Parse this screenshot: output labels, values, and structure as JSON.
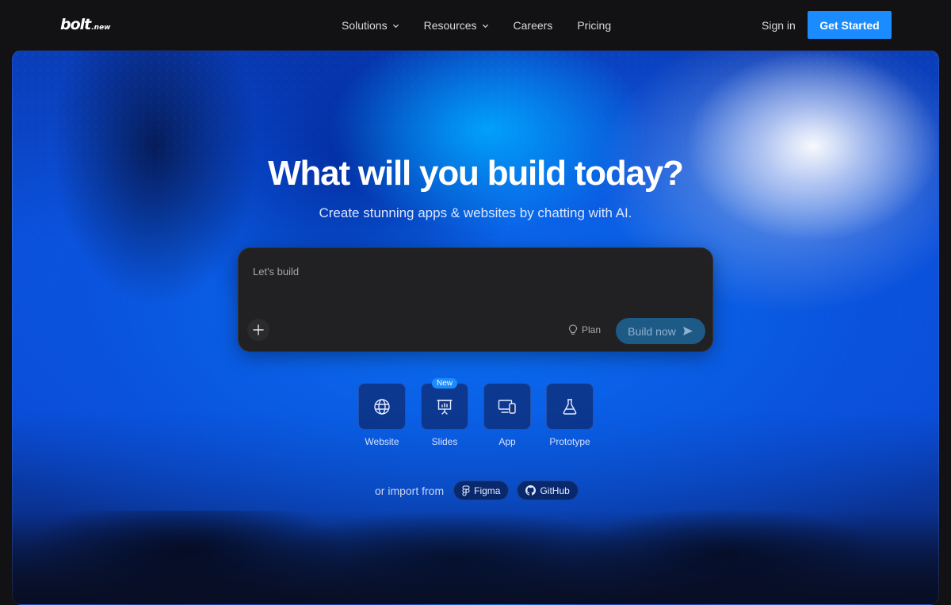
{
  "nav": {
    "logo_main": "bolt",
    "logo_sub": ".new",
    "links": [
      {
        "label": "Solutions",
        "dropdown": true
      },
      {
        "label": "Resources",
        "dropdown": true
      },
      {
        "label": "Careers",
        "dropdown": false
      },
      {
        "label": "Pricing",
        "dropdown": false
      }
    ],
    "signin": "Sign in",
    "cta": "Get Started"
  },
  "hero": {
    "title": "What will you build today?",
    "subtitle": "Create stunning apps & websites by chatting with AI."
  },
  "prompt": {
    "placeholder": "Let's build",
    "plan_label": "Plan",
    "build_label": "Build now"
  },
  "types": [
    {
      "label": "Website",
      "icon": "globe-icon",
      "badge": ""
    },
    {
      "label": "Slides",
      "icon": "presentation-icon",
      "badge": "New"
    },
    {
      "label": "App",
      "icon": "devices-icon",
      "badge": ""
    },
    {
      "label": "Prototype",
      "icon": "flask-icon",
      "badge": ""
    }
  ],
  "import": {
    "text": "or import from",
    "sources": [
      {
        "label": "Figma",
        "icon": "figma-icon"
      },
      {
        "label": "GitHub",
        "icon": "github-icon"
      }
    ]
  },
  "colors": {
    "accent": "#1a8cff",
    "background": "#121214",
    "prompt_bg": "#212123",
    "build_button": "#1e5a86"
  }
}
